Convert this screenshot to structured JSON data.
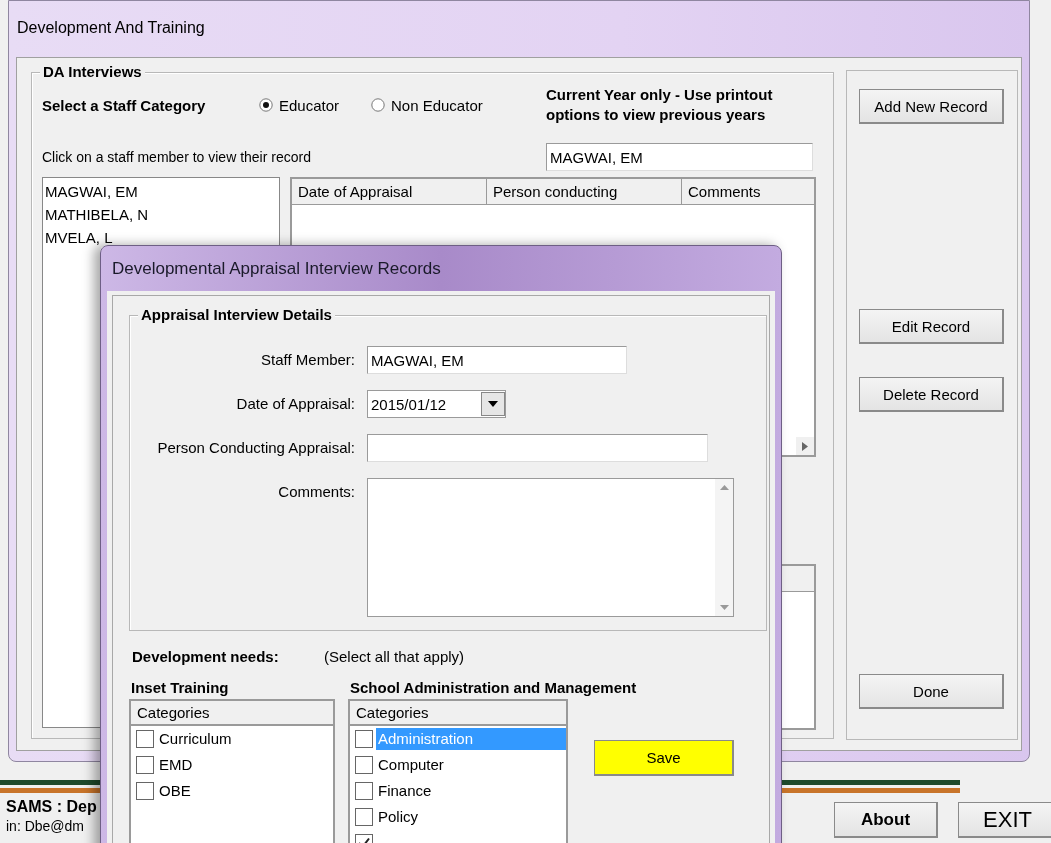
{
  "main_window": {
    "title": "Development And Training",
    "group_title": "DA Interviews",
    "staff_category": {
      "label": "Select a Staff Category",
      "options": [
        {
          "label": "Educator",
          "selected": true
        },
        {
          "label": "Non Educator",
          "selected": false
        }
      ]
    },
    "year_note": "Current Year only - Use printout options to view previous years",
    "list_hint": "Click on a staff member to view their record",
    "selected_staff": "MAGWAI, EM",
    "staff_list": [
      "MAGWAI, EM",
      "MATHIBELA, N",
      "MVELA, L"
    ],
    "records_table": {
      "columns": [
        "Date of Appraisal",
        "Person conducting",
        "Comments"
      ]
    },
    "buttons": [
      "Add New Record",
      "Edit Record",
      "Delete Record",
      "Done"
    ]
  },
  "dialog": {
    "title": "Developmental Appraisal Interview Records",
    "group_title": "Appraisal Interview Details",
    "fields": [
      {
        "label": "Staff Member:",
        "kind": "text",
        "value": "MAGWAI, EM"
      },
      {
        "label": "Date of Appraisal:",
        "kind": "date",
        "value": "2015/01/12"
      },
      {
        "label": "Person Conducting Appraisal:",
        "kind": "text"
      },
      {
        "label": "Comments:",
        "kind": "textarea"
      }
    ],
    "development_needs": {
      "label": "Development needs:",
      "hint": "(Select all that apply)"
    },
    "lists": [
      {
        "title": "Inset Training",
        "header": "Categories",
        "items": [
          {
            "label": "Curriculum",
            "checked": false,
            "selected": false
          },
          {
            "label": "EMD",
            "checked": false,
            "selected": false
          },
          {
            "label": "OBE",
            "checked": false,
            "selected": false
          }
        ]
      },
      {
        "title": "School Administration and Management",
        "header": "Categories",
        "items": [
          {
            "label": "Administration",
            "checked": false,
            "selected": true
          },
          {
            "label": "Computer",
            "checked": false,
            "selected": false
          },
          {
            "label": "Finance",
            "checked": false,
            "selected": false
          },
          {
            "label": "Policy",
            "checked": false,
            "selected": false
          },
          {
            "checked": true
          }
        ]
      }
    ],
    "save_button": "Save"
  },
  "footer": {
    "app_title": "SAMS : Dep",
    "login": "in: Dbe@dm",
    "buttons": [
      "About",
      "EXIT"
    ]
  }
}
